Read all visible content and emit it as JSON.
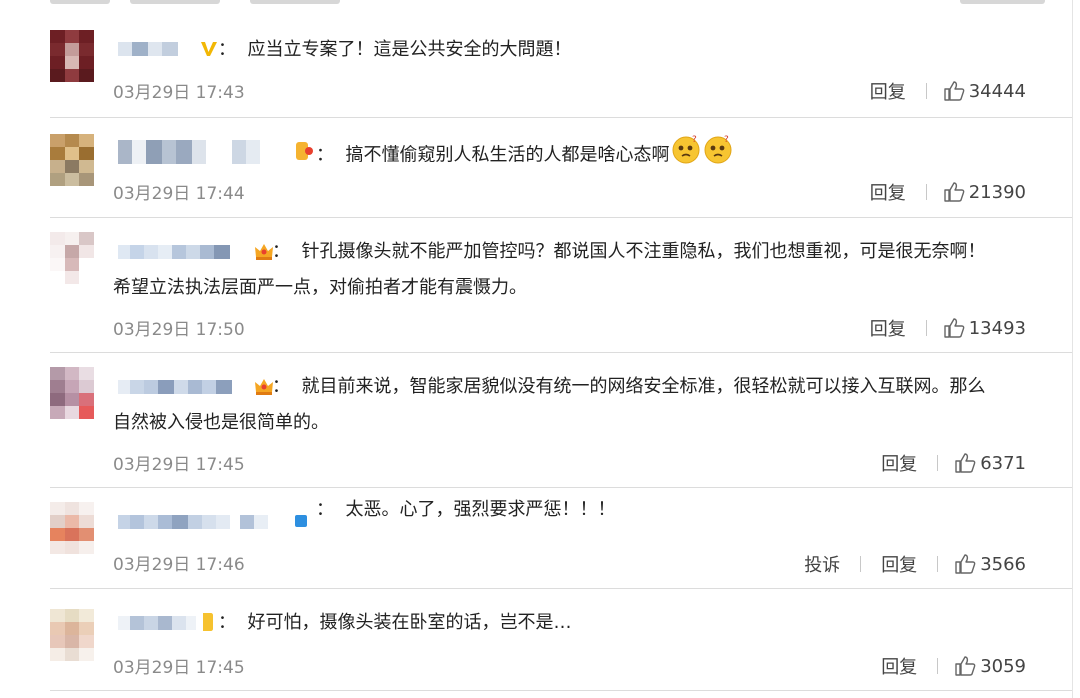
{
  "action_labels": {
    "reply": "回复",
    "report": "投诉"
  },
  "colors": {
    "verified_badge": "#f2b705",
    "crown_badge": "#f5a623",
    "text": "#222222",
    "timestamp": "#8a8a8a"
  },
  "comments": [
    {
      "text_lines": [
        "：  应当立专案了！這是公共安全的大問題！"
      ],
      "time": "03月29日 17:43",
      "likes": "34444",
      "badge": "verified-v-icon"
    },
    {
      "text_lines": [
        "：  搞不懂偷窥别人私生活的人都是啥心态啊"
      ],
      "time": "03月29日 17:44",
      "likes": "21390",
      "badge": "member-level-icon",
      "emoji": [
        "confused-face-emoji",
        "confused-face-emoji"
      ]
    },
    {
      "text_lines": [
        "：  针孔摄像头就不能严加管控吗？都说国人不注重隐私，我们也想重视，可是很无奈啊！",
        "希望立法执法层面严一点，对偷拍者才能有震慑力。"
      ],
      "time": "03月29日 17:50",
      "likes": "13493",
      "badge": "crown-icon"
    },
    {
      "text_lines": [
        "：  就目前来说，智能家居貌似没有统一的网络安全标准，很轻松就可以接入互联网。那么",
        "自然被入侵也是很简单的。"
      ],
      "time": "03月29日 17:45",
      "likes": "6371",
      "badge": "crown-icon"
    },
    {
      "text_lines": [
        "：  太恶。心了，强烈要求严惩！！！"
      ],
      "time": "03月29日 17:46",
      "likes": "3566",
      "badge": "blue-square-icon",
      "show_report": true
    },
    {
      "text_lines": [
        "：  好可怕，摄像头装在卧室的话，岂不是…"
      ],
      "time": "03月29日 17:45",
      "likes": "3059",
      "badge": "yellow-tag-icon"
    }
  ]
}
